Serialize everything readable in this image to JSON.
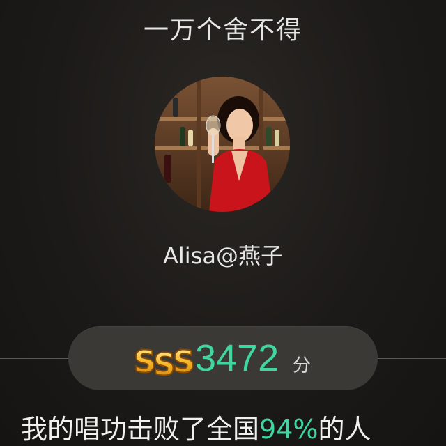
{
  "song": {
    "title": "一万个舍不得"
  },
  "user": {
    "name": "Alisa@燕子"
  },
  "score": {
    "grade": "SSS",
    "value": "3472",
    "unit": "分"
  },
  "result": {
    "prefix": "我的唱功击败了全国",
    "percent": "94%",
    "suffix": "的人"
  },
  "colors": {
    "accent": "#3fd6a0",
    "pill": "#3b3936",
    "background": "#1c1a18"
  }
}
